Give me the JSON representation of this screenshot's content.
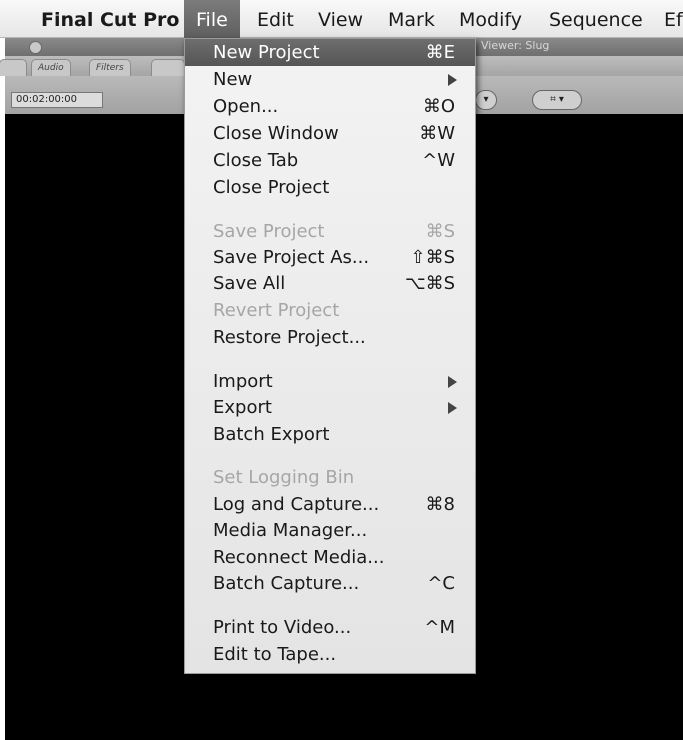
{
  "menubar": {
    "items": [
      {
        "label": "Final Cut Pro",
        "active": false
      },
      {
        "label": "File",
        "active": true
      },
      {
        "label": "Edit",
        "active": false
      },
      {
        "label": "View",
        "active": false
      },
      {
        "label": "Mark",
        "active": false
      },
      {
        "label": "Modify",
        "active": false
      },
      {
        "label": "Sequence",
        "active": false
      },
      {
        "label": "Ef",
        "active": false
      }
    ]
  },
  "viewer": {
    "title": "Viewer: Slug",
    "tabs": [
      "Audio",
      "Filters"
    ],
    "timecode": "00:02:00:00"
  },
  "file_menu": {
    "items": [
      {
        "label": "New Project",
        "shortcut": "⌘E",
        "highlighted": true
      },
      {
        "label": "New",
        "submenu": true
      },
      {
        "label": "Open...",
        "shortcut": "⌘O"
      },
      {
        "label": "Close Window",
        "shortcut": "⌘W"
      },
      {
        "label": "Close Tab",
        "shortcut": "^W"
      },
      {
        "label": "Close Project"
      },
      {
        "label": "Save Project",
        "shortcut": "⌘S",
        "disabled": true
      },
      {
        "label": "Save Project As...",
        "shortcut": "⇧⌘S"
      },
      {
        "label": "Save All",
        "shortcut": "⌥⌘S"
      },
      {
        "label": "Revert Project",
        "disabled": true
      },
      {
        "label": "Restore Project..."
      },
      {
        "label": "Import",
        "submenu": true
      },
      {
        "label": "Export",
        "submenu": true
      },
      {
        "label": "Batch Export"
      },
      {
        "label": "Set Logging Bin",
        "disabled": true
      },
      {
        "label": "Log and Capture...",
        "shortcut": "⌘8"
      },
      {
        "label": "Media Manager..."
      },
      {
        "label": "Reconnect Media..."
      },
      {
        "label": "Batch Capture...",
        "shortcut": "^C"
      },
      {
        "label": "Print to Video...",
        "shortcut": "^M"
      },
      {
        "label": "Edit to Tape..."
      }
    ]
  },
  "colors": {
    "menu_highlight": "#5f5f5f",
    "disabled_text": "#a6a6a6",
    "viewer_background": "#000000"
  }
}
